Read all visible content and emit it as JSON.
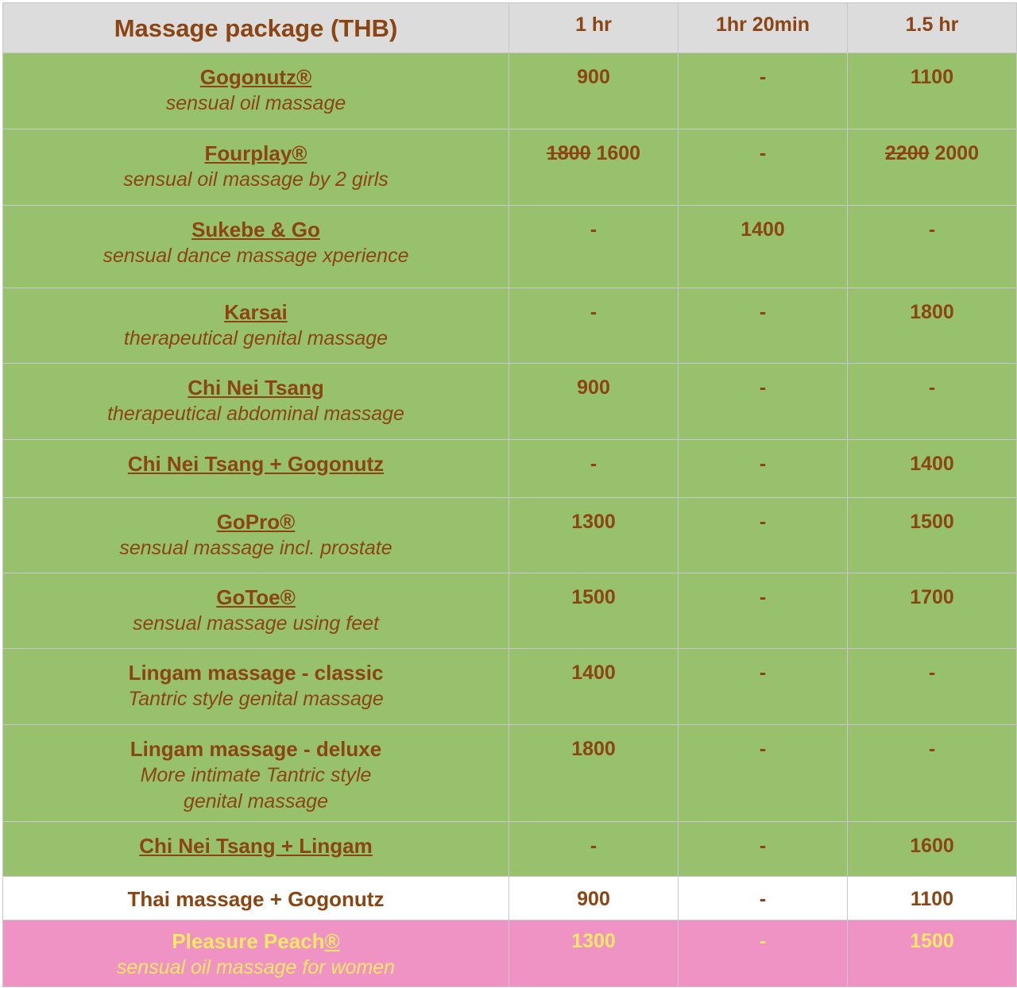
{
  "header": {
    "title": "Massage package (THB)",
    "columns": [
      "1 hr",
      "1hr 20min",
      "1.5 hr"
    ]
  },
  "rows": [
    {
      "name": "Gogonutz®",
      "desc": "sensual oil massage",
      "p1": "900",
      "p2": "-",
      "p3": "1100"
    },
    {
      "name": "Fourplay®",
      "desc": "sensual oil massage by 2 girls",
      "p1_old": "1800",
      "p1": "1600",
      "p2": "-",
      "p3_old": "2200",
      "p3": "2000"
    },
    {
      "name": "Sukebe & Go",
      "desc": "sensual dance massage xperience",
      "p1": "-",
      "p2": "1400",
      "p3": "-"
    },
    {
      "name": "Karsai",
      "desc": "therapeutical genital massage",
      "p1": "-",
      "p2": "-",
      "p3": "1800"
    },
    {
      "name": "Chi Nei Tsang",
      "desc": "therapeutical abdominal massage",
      "p1": "900",
      "p2": "-",
      "p3": "-"
    },
    {
      "name": "Chi Nei Tsang + Gogonutz",
      "p1": "-",
      "p2": "-",
      "p3": "1400"
    },
    {
      "name": "GoPro®",
      "desc": "sensual massage incl. prostate",
      "p1": "1300",
      "p2": "-",
      "p3": "1500"
    },
    {
      "name": "GoToe®",
      "desc": "sensual massage using feet",
      "p1": "1500",
      "p2": "-",
      "p3": "1700"
    },
    {
      "name": "Lingam massage - classic",
      "desc": "Tantric style genital massage",
      "p1": "1400",
      "p2": "-",
      "p3": "-"
    },
    {
      "name": "Lingam massage - deluxe",
      "desc_line1": "More intimate Tantric style",
      "desc_line2": "genital massage",
      "p1": "1800",
      "p2": "-",
      "p3": "-"
    },
    {
      "name": "Chi Nei Tsang + Lingam",
      "p1": "-",
      "p2": "-",
      "p3": "1600"
    },
    {
      "name": "Thai massage + Gogonutz",
      "p1": "900",
      "p2": "-",
      "p3": "1100"
    },
    {
      "name": "Pleasure Peach®",
      "desc": "sensual oil massage for women",
      "p1": "1300",
      "p2": "-",
      "p3": "1500"
    }
  ],
  "colors": {
    "text": "#8b4513",
    "header_bg": "#dcdcdc",
    "green_bg": "#98c16e",
    "pink_bg": "#ef93c4",
    "pink_text": "#ffe866"
  }
}
